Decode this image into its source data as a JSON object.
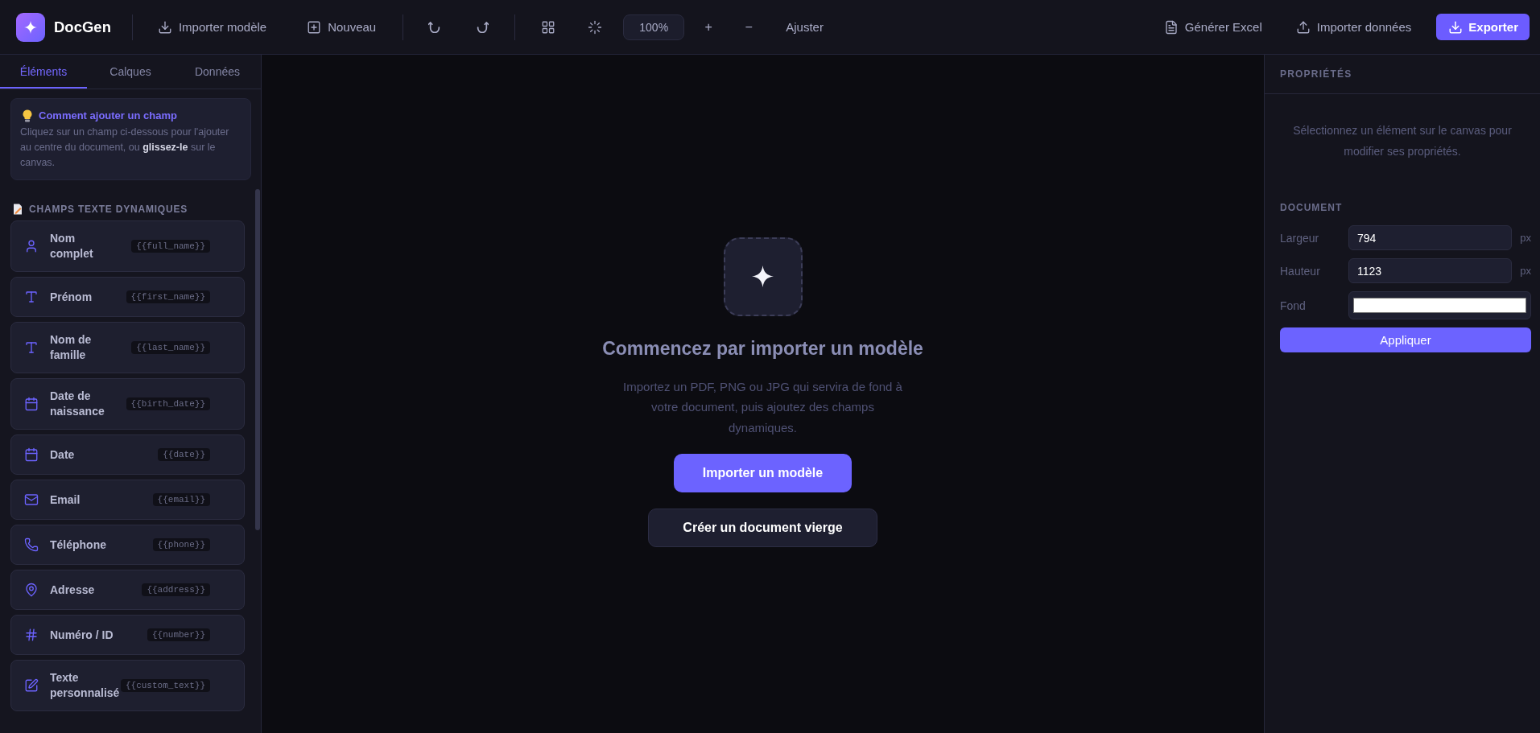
{
  "app": {
    "name": "DocGen"
  },
  "toolbar": {
    "file_actions": [
      "Importer modèle",
      "Nouveau"
    ],
    "zoom": {
      "value": "100%",
      "zoom_in": "+",
      "zoom_out": "−",
      "fit": "Ajuster"
    },
    "data_actions": [
      "Générer Excel",
      "Importer données"
    ],
    "export": "Exporter"
  },
  "sidebar": {
    "tabs": [
      {
        "label": "Éléments",
        "selected": true
      },
      {
        "label": "Calques",
        "selected": false
      },
      {
        "label": "Données",
        "selected": false
      }
    ],
    "hint": {
      "title": "Comment ajouter un champ",
      "text": "Cliquez sur un champ ci-dessous pour l'ajouter au centre du document, ou **glissez-le** sur le canvas."
    },
    "section": {
      "title": "CHAMPS TEXTE DYNAMIQUES",
      "fields": [
        {
          "label": "Nom complet",
          "token": "{{full_name}}"
        },
        {
          "label": "Prénom",
          "token": "{{first_name}}"
        },
        {
          "label": "Nom de famille",
          "token": "{{last_name}}"
        },
        {
          "label": "Date de naissance",
          "token": "{{birth_date}}"
        },
        {
          "label": "Date",
          "token": "{{date}}"
        },
        {
          "label": "Email",
          "token": "{{email}}"
        },
        {
          "label": "Téléphone",
          "token": "{{phone}}"
        },
        {
          "label": "Adresse",
          "token": "{{address}}"
        },
        {
          "label": "Numéro / ID",
          "token": "{{number}}"
        },
        {
          "label": "Texte personnalisé",
          "token": "{{custom_text}}"
        }
      ]
    }
  },
  "canvas": {
    "empty_state": {
      "title": "Commencez par importer un modèle",
      "text": "Importez un PDF, PNG ou JPG qui servira de fond à votre document, puis ajoutez des champs dynamiques.",
      "primary_button": "Importer un modèle",
      "secondary_button": "Créer un document vierge"
    }
  },
  "properties": {
    "title": "PROPRIÉTÉS",
    "message": "Sélectionnez un élément sur le canvas pour modifier ses propriétés.",
    "document": {
      "title": "DOCUMENT",
      "width": {
        "label": "Largeur",
        "value": "794",
        "unit": "px"
      },
      "height": {
        "label": "Hauteur",
        "value": "1123",
        "unit": "px"
      },
      "background": {
        "label": "Fond",
        "color": "#ffffff"
      },
      "apply": "Appliquer"
    }
  }
}
